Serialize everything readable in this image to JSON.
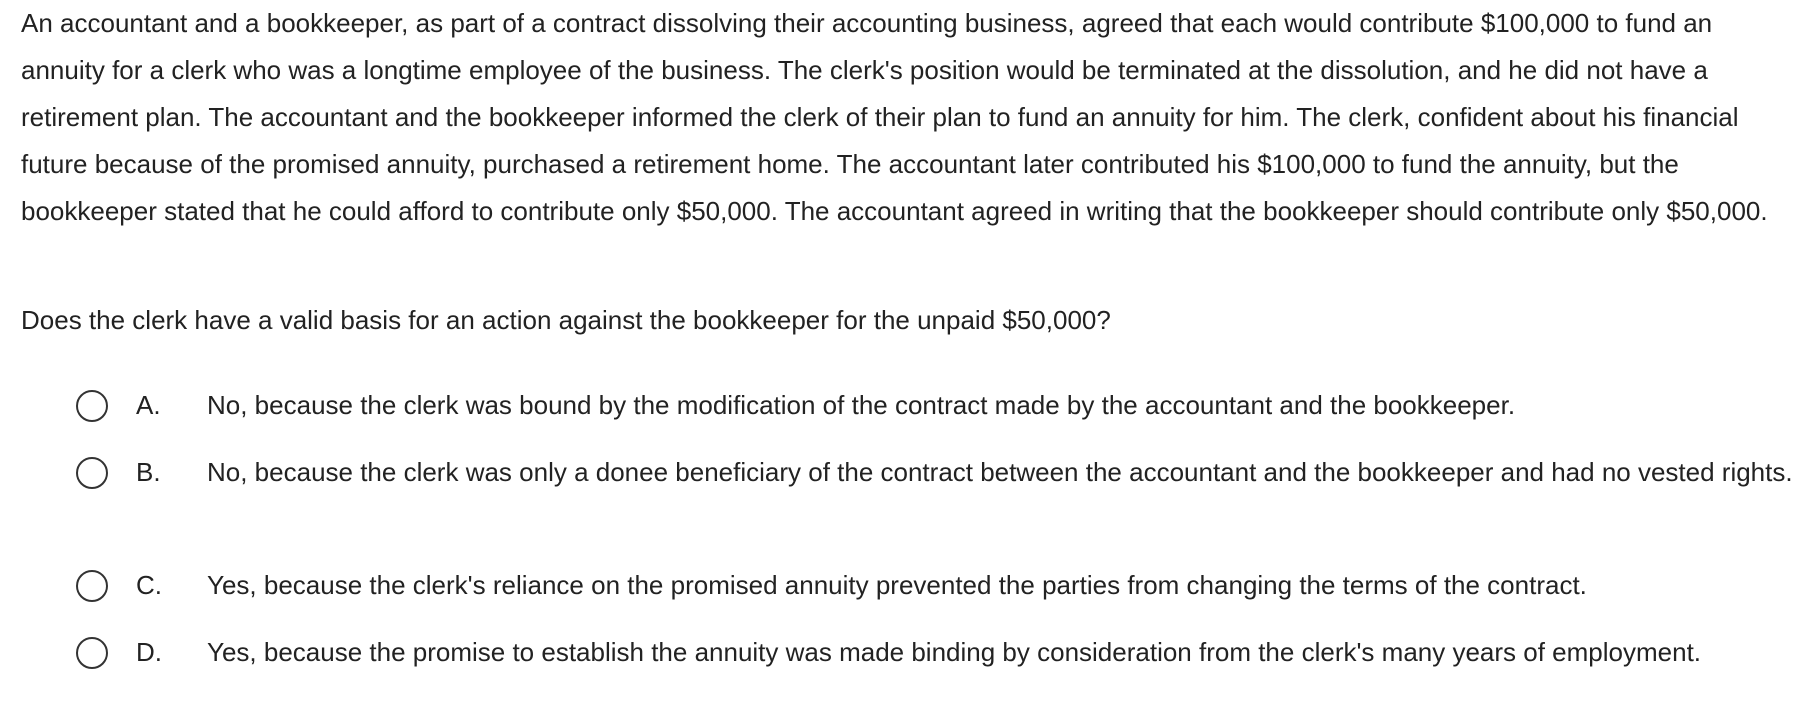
{
  "question": {
    "stem": "An accountant and a bookkeeper, as part of a contract dissolving their accounting business, agreed that each would contribute $100,000 to fund an annuity for a clerk who was a longtime employee of the business.  The clerk's position would be terminated at the dissolution, and he did not have a retirement plan.  The accountant and the bookkeeper informed the clerk of their plan to fund an annuity for him.  The clerk, confident about his financial future because of the promised annuity, purchased a retirement home.  The accountant later contributed his $100,000 to fund the annuity, but the bookkeeper stated that he could afford to contribute only $50,000.  The accountant agreed in writing that the bookkeeper should contribute only $50,000.",
    "prompt": "Does the clerk have a valid basis for an action against the bookkeeper for the unpaid $50,000?"
  },
  "choices": [
    {
      "letter": "A.",
      "text": "No, because the clerk was bound by the modification of the contract made by the accountant and the bookkeeper.",
      "selected": false
    },
    {
      "letter": "B.",
      "text": "No, because the clerk was only a donee beneficiary of the contract between the accountant and the bookkeeper and had no vested rights.",
      "selected": false
    },
    {
      "letter": "C.",
      "text": "Yes, because the clerk's reliance on the promised annuity prevented the parties from changing the terms of the contract.",
      "selected": false
    },
    {
      "letter": "D.",
      "text": "Yes, because the promise to establish the annuity was made binding by consideration from the clerk's many years of employment.",
      "selected": false
    }
  ]
}
